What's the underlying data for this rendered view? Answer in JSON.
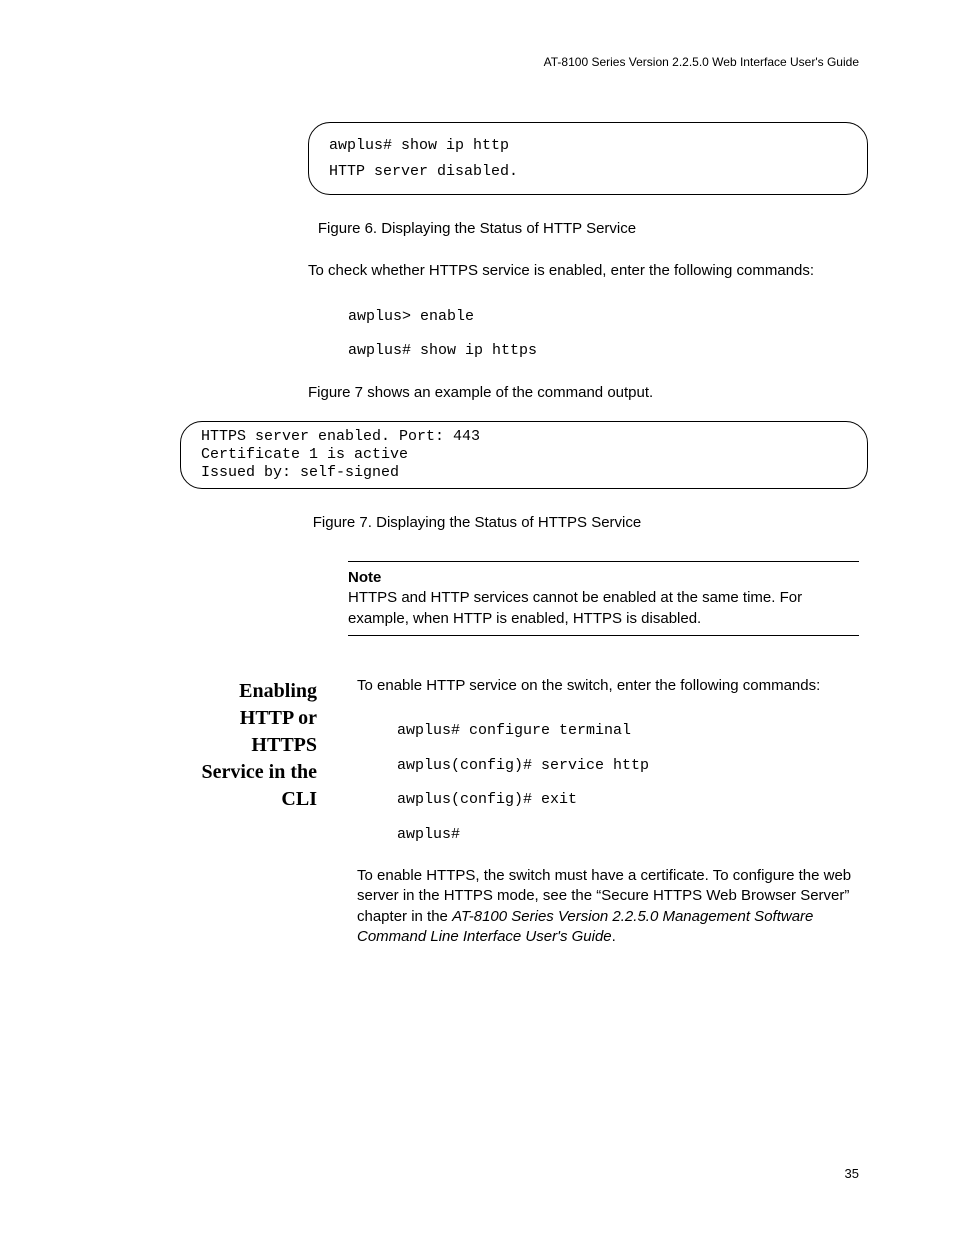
{
  "header": {
    "running": "AT-8100 Series Version 2.2.5.0 Web Interface User's Guide"
  },
  "box1": {
    "line1": "awplus# show ip http",
    "line2": "HTTP server disabled."
  },
  "fig6_caption": "Figure 6. Displaying the Status of HTTP Service",
  "para1": "To check whether HTTPS service is enabled, enter the following commands:",
  "cmd1": {
    "line1": "awplus> enable",
    "line2": "awplus# show ip https"
  },
  "para2": "Figure 7 shows an example of the command output.",
  "box2": {
    "line1": "HTTPS server enabled. Port: 443",
    "line2": "Certificate 1 is active",
    "line3": "Issued by: self-signed"
  },
  "fig7_caption": "Figure 7. Displaying the Status of HTTPS Service",
  "note": {
    "title": "Note",
    "body": "HTTPS and HTTP services cannot be enabled at the same time. For example, when HTTP is enabled, HTTPS is disabled."
  },
  "side_heading": "Enabling HTTP or HTTPS Service in the CLI",
  "para3": "To enable HTTP service on the switch, enter the following commands:",
  "cmd2": {
    "line1": "awplus# configure terminal",
    "line2": "awplus(config)# service http",
    "line3": "awplus(config)# exit",
    "line4": "awplus#"
  },
  "para4_pre": "To enable HTTPS, the switch must have a certificate. To configure the web server in the HTTPS mode, see the “Secure HTTPS Web Browser Server” chapter in the ",
  "para4_ital": "AT-8100 Series Version 2.2.5.0 Management Software Command Line Interface User's Guide",
  "para4_post": ".",
  "page_number": "35"
}
